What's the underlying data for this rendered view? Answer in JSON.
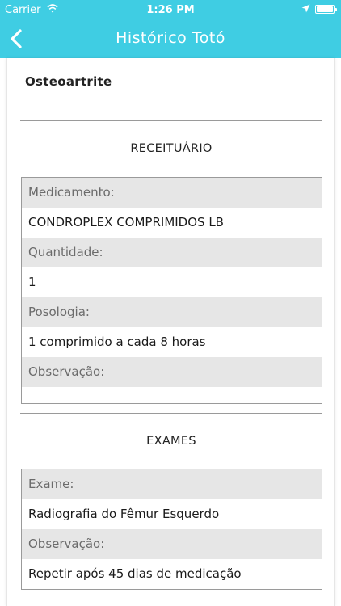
{
  "status_bar": {
    "carrier": "Carrier",
    "time": "1:26 PM"
  },
  "nav": {
    "title": "Histórico Totó",
    "back_icon": "chevron-left-icon",
    "background_color": "#3fcde3"
  },
  "diagnosis": "Osteoartrite",
  "prescription": {
    "section_title": "RECEITUÁRIO",
    "fields": [
      {
        "label": "Medicamento:",
        "value": "CONDROPLEX COMPRIMIDOS LB"
      },
      {
        "label": "Quantidade:",
        "value": "1"
      },
      {
        "label": "Posologia:",
        "value": "1 comprimido a cada 8 horas"
      },
      {
        "label": "Observação:",
        "value": ""
      }
    ]
  },
  "exams": {
    "section_title": "EXAMES",
    "fields": [
      {
        "label": "Exame:",
        "value": "Radiografia do Fêmur Esquerdo"
      },
      {
        "label": "Observação:",
        "value": "Repetir após 45 dias de medicação"
      }
    ]
  }
}
